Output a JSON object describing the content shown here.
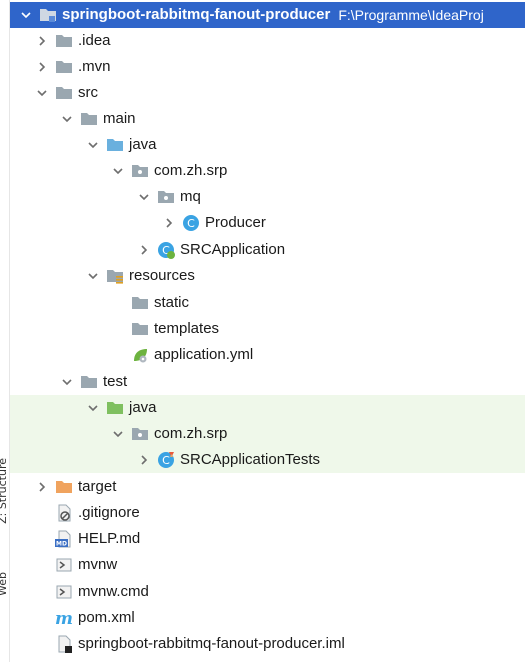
{
  "sidebar_tabs": [
    "Z: Structure",
    "Web"
  ],
  "tree": {
    "root": {
      "name": "springboot-rabbitmq-fanout-producer",
      "path": "F:\\Programme\\IdeaProj"
    },
    "items": [
      {
        "label": ".idea",
        "icon": "folder-icon"
      },
      {
        "label": ".mvn",
        "icon": "folder-icon"
      },
      {
        "label": "src",
        "icon": "folder-icon"
      },
      {
        "label": "main",
        "icon": "folder-icon"
      },
      {
        "label": "java",
        "icon": "source-folder-icon"
      },
      {
        "label": "com.zh.srp",
        "icon": "package-icon"
      },
      {
        "label": "mq",
        "icon": "package-icon"
      },
      {
        "label": "Producer",
        "icon": "java-class-icon"
      },
      {
        "label": "SRCApplication",
        "icon": "spring-boot-class-icon"
      },
      {
        "label": "resources",
        "icon": "resources-folder-icon"
      },
      {
        "label": "static",
        "icon": "folder-icon"
      },
      {
        "label": "templates",
        "icon": "folder-icon"
      },
      {
        "label": "application.yml",
        "icon": "spring-config-icon"
      },
      {
        "label": "test",
        "icon": "folder-icon"
      },
      {
        "label": "java",
        "icon": "test-source-folder-icon"
      },
      {
        "label": "com.zh.srp",
        "icon": "package-icon"
      },
      {
        "label": "SRCApplicationTests",
        "icon": "test-class-icon"
      },
      {
        "label": "target",
        "icon": "excluded-folder-icon"
      },
      {
        "label": ".gitignore",
        "icon": "gitignore-file-icon"
      },
      {
        "label": "HELP.md",
        "icon": "markdown-file-icon"
      },
      {
        "label": "mvnw",
        "icon": "shell-script-icon"
      },
      {
        "label": "mvnw.cmd",
        "icon": "cmd-file-icon"
      },
      {
        "label": "pom.xml",
        "icon": "maven-pom-icon"
      },
      {
        "label": "springboot-rabbitmq-fanout-producer.iml",
        "icon": "iml-file-icon"
      }
    ]
  },
  "colors": {
    "selection": "#2f65ca",
    "test_background": "#eff8ea",
    "folder": "#9aa7b0",
    "source_folder": "#6ab0de",
    "test_folder": "#7fc060",
    "excluded_folder": "#f0a35e",
    "class_circle": "#3aa3e3"
  }
}
